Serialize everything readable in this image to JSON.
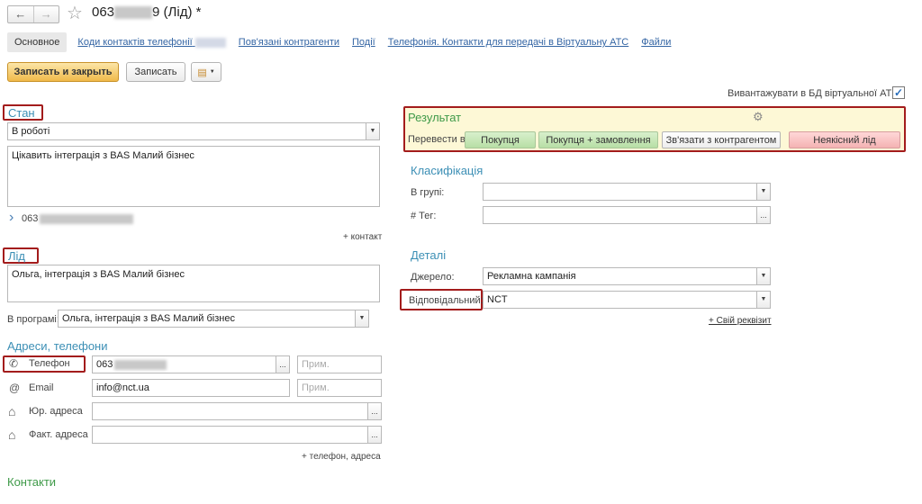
{
  "window": {
    "title_prefix": "063",
    "title_suffix": "9 (Лід) *",
    "star": "☆"
  },
  "tabs": [
    {
      "label": "Основное"
    },
    {
      "label": "Коди контактів телефонії"
    },
    {
      "label": "Пов'язані контрагенти"
    },
    {
      "label": "Події"
    },
    {
      "label": "Телефонія. Контакти для передачі в Віртуальну АТС"
    },
    {
      "label": "Файли"
    }
  ],
  "toolbar": {
    "save_close_label": "Записать и закрыть",
    "save_label": "Записать"
  },
  "export_checkbox": {
    "label": "Вивантажувати в БД віртуальної АТС:",
    "checked": "✓"
  },
  "stan": {
    "title": "Стан",
    "status_value": "В роботі",
    "comment": "Цікавить інтеграція з BAS Малий бізнес",
    "contact_phone_prefix": "063",
    "add_contact_link": "+ контакт"
  },
  "lid": {
    "title": "Лід",
    "description": "Ольга, інтеграція з BAS Малий бізнес",
    "program_label": "В програмі:",
    "program_value": "Ольга, інтеграція з BAS Малий бізнес"
  },
  "addresses": {
    "title": "Адреси, телефони",
    "phone_label": "Телефон",
    "phone_value_prefix": "063",
    "note_placeholder": "Прим.",
    "email_label": "Email",
    "email_value": "info@nct.ua",
    "legal_address_label": "Юр. адреса",
    "actual_address_label": "Факт. адреса",
    "add_link": "+ телефон, адреса"
  },
  "contacts": {
    "title": "Контакти"
  },
  "result": {
    "title": "Результат",
    "convert_label": "Перевести в:",
    "buttons": [
      "Покупця",
      "Покупця + замовлення",
      "Зв'язати з контрагентом",
      "Неякісний лід"
    ]
  },
  "classification": {
    "title": "Класифікація",
    "group_label": "В групі:",
    "tag_label": "# Тег:"
  },
  "details": {
    "title": "Деталі",
    "source_label": "Джерело:",
    "source_value": "Рекламна кампанія",
    "responsible_label": "Відповідальний:",
    "responsible_value": "NCT",
    "custom_attr_link": "+ Свій реквізит"
  },
  "icons": {
    "back": "←",
    "forward": "→",
    "dropdown": "▼",
    "ellipsis": "...",
    "chevron": "›",
    "gear": "⚙",
    "phone": "✆",
    "at": "@",
    "house": "⌂"
  }
}
